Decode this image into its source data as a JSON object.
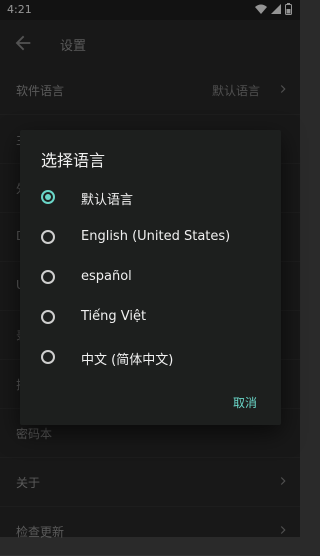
{
  "status": {
    "time": "4:21"
  },
  "appbar": {
    "title": "设置"
  },
  "settings": {
    "items": [
      {
        "label": "软件语言",
        "value": "默认语言"
      },
      {
        "label": "主",
        "value": ""
      },
      {
        "label": "外",
        "value": ""
      },
      {
        "label": "D",
        "value": ""
      },
      {
        "label": "U",
        "value": ""
      },
      {
        "label": "录",
        "value": ""
      },
      {
        "label": "拉",
        "value": ""
      },
      {
        "label": "密码本",
        "value": ""
      },
      {
        "label": "关于",
        "value": ""
      },
      {
        "label": "检查更新",
        "value": ""
      }
    ]
  },
  "dialog": {
    "title": "选择语言",
    "options": [
      {
        "label": "默认语言",
        "checked": true
      },
      {
        "label": "English (United States)",
        "checked": false
      },
      {
        "label": "español",
        "checked": false
      },
      {
        "label": "Tiếng Việt",
        "checked": false
      },
      {
        "label": "中文 (简体中文)",
        "checked": false
      }
    ],
    "cancel_label": "取消"
  },
  "colors": {
    "accent": "#6ad6c8",
    "background": "#2a2a2a",
    "dialog": "#1d1f1e"
  }
}
